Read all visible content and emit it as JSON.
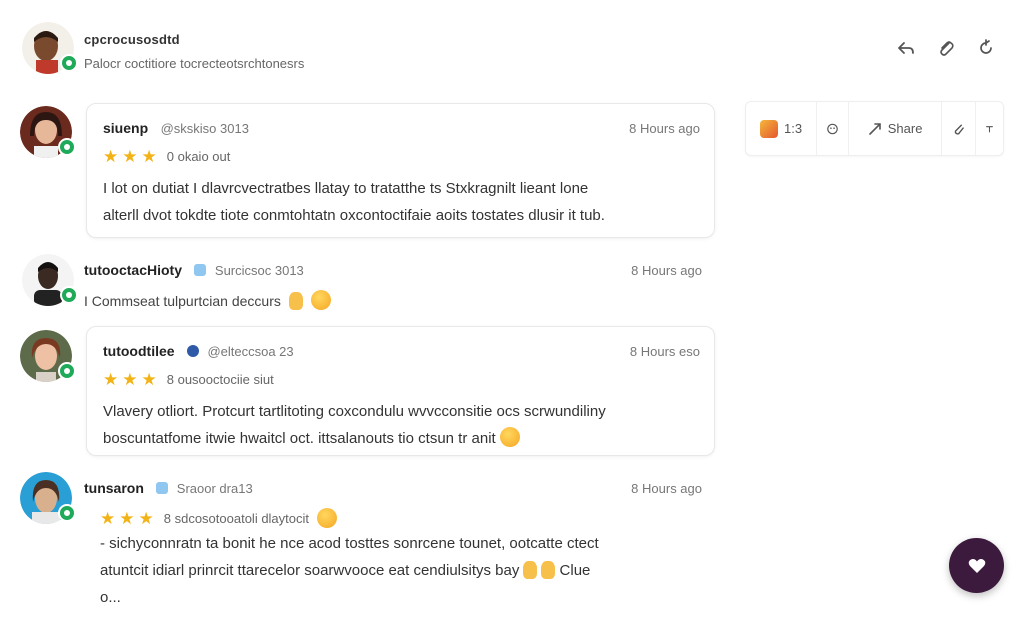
{
  "header": {
    "name": "cpcrocusosdtd",
    "subtitle": "Palocr coctitiore tocrecteotsrchtonesrs"
  },
  "toolbar": {
    "reaction_emoji_count": "1:3",
    "share_label": "Share"
  },
  "messages": [
    {
      "author": "siuenp",
      "handle": "@skskiso 3013",
      "time": "8 Hours ago",
      "rating_label": "0 okaio out",
      "stars": 3,
      "body_line1": "I lot on dutiat I dlavrcvectratbes llatay to tratatthe ts Stxkragnilt lieant lone",
      "body_line2": "alterll dvot tokdte tiote conmtohtatn oxcontoctifaie aoits tostates dlusir it tub."
    },
    {
      "author": "tutooctacHioty",
      "handle": "Surcicsoc 3013",
      "time": "8 Hours ago",
      "body_line1": "I Commseat tulpurtcian deccurs"
    },
    {
      "author": "tutoodtilee",
      "handle": "@elteccsoa 23",
      "time": "8 Hours eso",
      "rating_label": "8 ousooctociie siut",
      "stars": 3,
      "body_line1": "Vlavery otliort. Protcurt tartlitoting coxcondulu wvvcconsitie ocs scrwundiliny",
      "body_line2": "boscuntatfome itwie hwaitcl oct. ittsalanouts tio ctsun tr anit"
    },
    {
      "author": "tunsaron",
      "handle": "Sraoor dra13",
      "time": "8 Hours ago",
      "rating_label": "8 sdcosotooatoli dlaytocit",
      "stars": 3,
      "body_line1": "- sichyconnratn ta bonit he nce acod tosttes sonrcene tounet, ootcatte ctect",
      "body_line2": "atuntcit idiarl prinrcit ttarecelor soarwvooce eat cendiulsitys bay",
      "body_line3": "Clue",
      "body_more": "o..."
    }
  ],
  "colors": {
    "status_online": "#1faa59",
    "star": "#f2b317",
    "fab_bg": "#3b1a3d"
  }
}
